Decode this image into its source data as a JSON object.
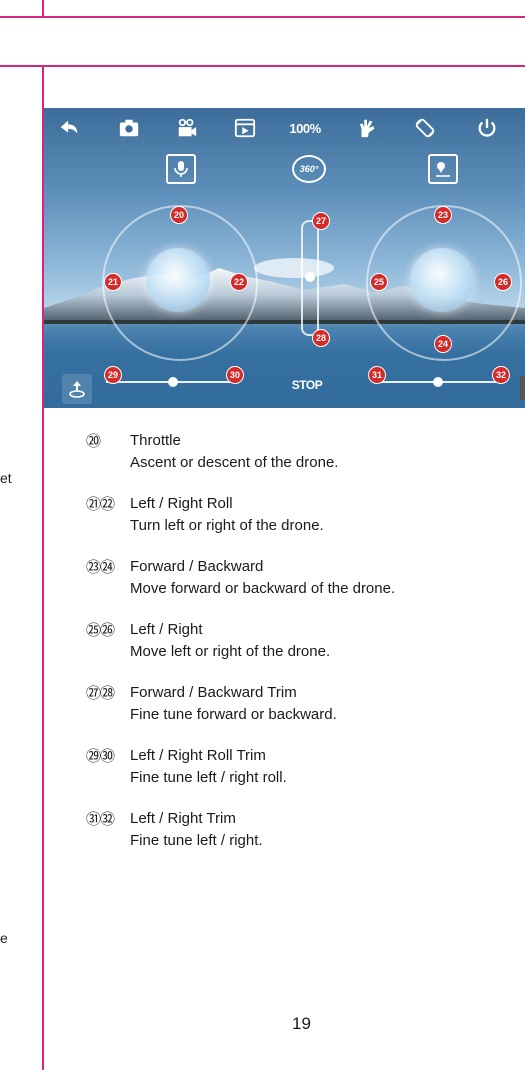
{
  "stray_text": {
    "left_mid": "et",
    "left_low": "e"
  },
  "screen": {
    "toolbar": {
      "zoom_label": "100%"
    },
    "badges": {
      "b20": "20",
      "b21": "21",
      "b22": "22",
      "b23": "23",
      "b24": "24",
      "b25": "25",
      "b26": "26",
      "b27": "27",
      "b28": "28",
      "b29": "29",
      "b30": "30",
      "b31": "31",
      "b32": "32"
    },
    "rotate_label": "360°",
    "stop_label": "STOP",
    "icons": [
      "back-icon",
      "camera-icon",
      "video-icon",
      "gallery-icon",
      "speed-label",
      "gesture-icon",
      "screen-rotate-icon",
      "power-icon",
      "microphone-icon",
      "rotate-360-icon",
      "waypoint-icon",
      "takeoff-icon",
      "stop-button"
    ]
  },
  "legend": [
    {
      "nums": "⑳",
      "title": "Throttle",
      "desc": "Ascent or descent of the drone."
    },
    {
      "nums": "㉑㉒",
      "title": "Left / Right Roll",
      "desc": "Turn left or right of the drone."
    },
    {
      "nums": "㉓㉔",
      "title": "Forward / Backward",
      "desc": "Move forward or backward of the drone."
    },
    {
      "nums": "㉕㉖",
      "title": "Left / Right",
      "desc": "Move left or right of the drone."
    },
    {
      "nums": "㉗㉘",
      "title": "Forward / Backward Trim",
      "desc": "Fine tune forward or backward."
    },
    {
      "nums": "㉙㉚",
      "title": "Left / Right Roll Trim",
      "desc": "Fine tune left / right roll."
    },
    {
      "nums": "㉛㉜",
      "title": "Left / Right Trim",
      "desc": "Fine tune left / right."
    }
  ],
  "page_number": "19",
  "colors": {
    "accent": "#d6257f",
    "badge": "#d42a2a"
  }
}
